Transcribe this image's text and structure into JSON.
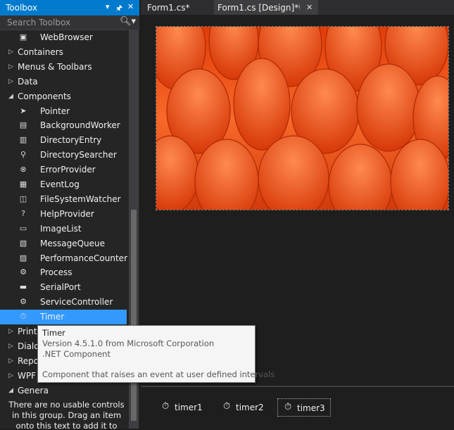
{
  "toolbox": {
    "title": "Toolbox",
    "dropdown_glyph": "▾",
    "pin_glyph": "🖈",
    "close_glyph": "✕",
    "search_placeholder": "Search Toolbox",
    "search_icon": "search-icon",
    "items": [
      {
        "label": "WebBrowser",
        "kind": "item",
        "icon": "globe-icon",
        "glyph": "▣"
      },
      {
        "label": "Containers",
        "kind": "group-collapsed",
        "glyph": "▷"
      },
      {
        "label": "Menus & Toolbars",
        "kind": "group-collapsed",
        "glyph": "▷"
      },
      {
        "label": "Data",
        "kind": "group-collapsed",
        "glyph": "▷"
      },
      {
        "label": "Components",
        "kind": "group-expanded",
        "glyph": "◢"
      },
      {
        "label": "Pointer",
        "kind": "item",
        "icon": "pointer-icon",
        "glyph": "➤"
      },
      {
        "label": "BackgroundWorker",
        "kind": "item",
        "icon": "background-worker-icon",
        "glyph": "▤"
      },
      {
        "label": "DirectoryEntry",
        "kind": "item",
        "icon": "directory-entry-icon",
        "glyph": "▥"
      },
      {
        "label": "DirectorySearcher",
        "kind": "item",
        "icon": "directory-searcher-icon",
        "glyph": "⚲"
      },
      {
        "label": "ErrorProvider",
        "kind": "item",
        "icon": "error-provider-icon",
        "glyph": "⊗"
      },
      {
        "label": "EventLog",
        "kind": "item",
        "icon": "event-log-icon",
        "glyph": "▦"
      },
      {
        "label": "FileSystemWatcher",
        "kind": "item",
        "icon": "file-system-watcher-icon",
        "glyph": "◫"
      },
      {
        "label": "HelpProvider",
        "kind": "item",
        "icon": "help-provider-icon",
        "glyph": "?"
      },
      {
        "label": "ImageList",
        "kind": "item",
        "icon": "image-list-icon",
        "glyph": "▭"
      },
      {
        "label": "MessageQueue",
        "kind": "item",
        "icon": "message-queue-icon",
        "glyph": "▧"
      },
      {
        "label": "PerformanceCounter",
        "kind": "item",
        "icon": "performance-counter-icon",
        "glyph": "▨"
      },
      {
        "label": "Process",
        "kind": "item",
        "icon": "process-icon",
        "glyph": "⚙"
      },
      {
        "label": "SerialPort",
        "kind": "item",
        "icon": "serial-port-icon",
        "glyph": "▬"
      },
      {
        "label": "ServiceController",
        "kind": "item",
        "icon": "service-controller-icon",
        "glyph": "⚙"
      },
      {
        "label": "Timer",
        "kind": "item-selected",
        "icon": "timer-icon",
        "glyph": "⏱"
      },
      {
        "label": "Printi",
        "kind": "group-collapsed",
        "glyph": "▷"
      },
      {
        "label": "Dialo",
        "kind": "group-collapsed",
        "glyph": "▷"
      },
      {
        "label": "Repor",
        "kind": "group-collapsed",
        "glyph": "▷"
      },
      {
        "label": "WPF I",
        "kind": "group-collapsed",
        "glyph": "▷"
      },
      {
        "label": "Genera",
        "kind": "group-expanded",
        "glyph": "◢"
      }
    ],
    "general_note": "There are no usable controls in this group. Drag an item onto this text to add it to the"
  },
  "tabs": [
    {
      "label": "Form1.cs*",
      "active": false
    },
    {
      "label": "Form1.cs [Design]*",
      "active": true,
      "pin_glyph": "⊣",
      "close_glyph": "✕"
    }
  ],
  "tooltip": {
    "title": "Timer",
    "version": "Version 4.5.1.0 from Microsoft Corporation",
    "component": ".NET Component",
    "description": "Component that raises an event at user defined intervals"
  },
  "component_tray": [
    {
      "name": "timer1",
      "icon": "timer-icon",
      "glyph": "⏱"
    },
    {
      "name": "timer2",
      "icon": "timer-icon",
      "glyph": "⏱"
    },
    {
      "name": "timer3",
      "icon": "timer-icon",
      "glyph": "⏱",
      "selected": true
    }
  ],
  "colors": {
    "accent": "#007acc",
    "selection": "#3399ff",
    "background": "#1e1e1e",
    "panel": "#252526"
  }
}
